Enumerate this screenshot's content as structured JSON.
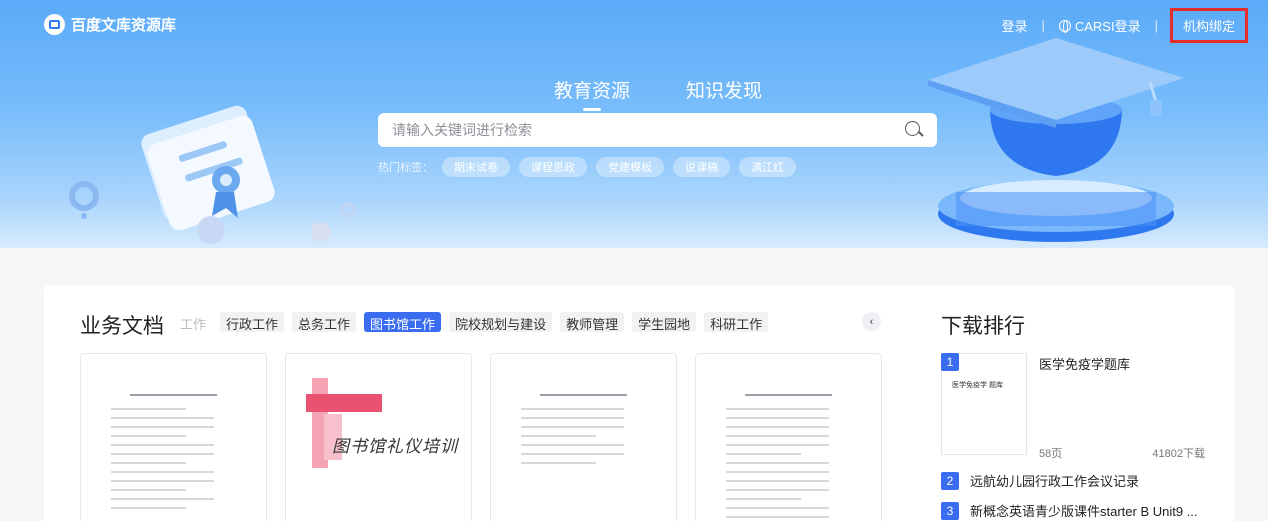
{
  "brand": {
    "name": "百度文库资源库"
  },
  "topnav": {
    "login": "登录",
    "carsi": "CARSI登录",
    "bind": "机构绑定"
  },
  "tabs": [
    "教育资源",
    "知识发现"
  ],
  "search": {
    "placeholder": "请输入关键词进行检索"
  },
  "hot": {
    "label": "热门标签：",
    "tags": [
      "期末试卷",
      "课程思政",
      "党建模板",
      "说课稿",
      "满江红"
    ]
  },
  "business": {
    "title": "业务文档",
    "categories": [
      "工作",
      "行政工作",
      "总务工作",
      "图书馆工作",
      "院校规划与建设",
      "教师管理",
      "学生园地",
      "科研工作"
    ],
    "active_category": "图书馆工作"
  },
  "docs": {
    "art_text": "图书馆礼仪培训"
  },
  "ranking": {
    "title": "下载排行",
    "items": [
      {
        "rank": "1",
        "name": "医学免疫学题库",
        "thumb": "医学免疫学  题库",
        "pages": "58页",
        "downloads": "41802下载"
      },
      {
        "rank": "2",
        "name": "远航幼儿园行政工作会议记录"
      },
      {
        "rank": "3",
        "name": "新概念英语青少版课件starter B Unit9 ..."
      }
    ]
  },
  "colors": {
    "accent": "#3a6cf0",
    "highlight_box": "#e52d2d",
    "hero_top": "#5aaaf8"
  }
}
